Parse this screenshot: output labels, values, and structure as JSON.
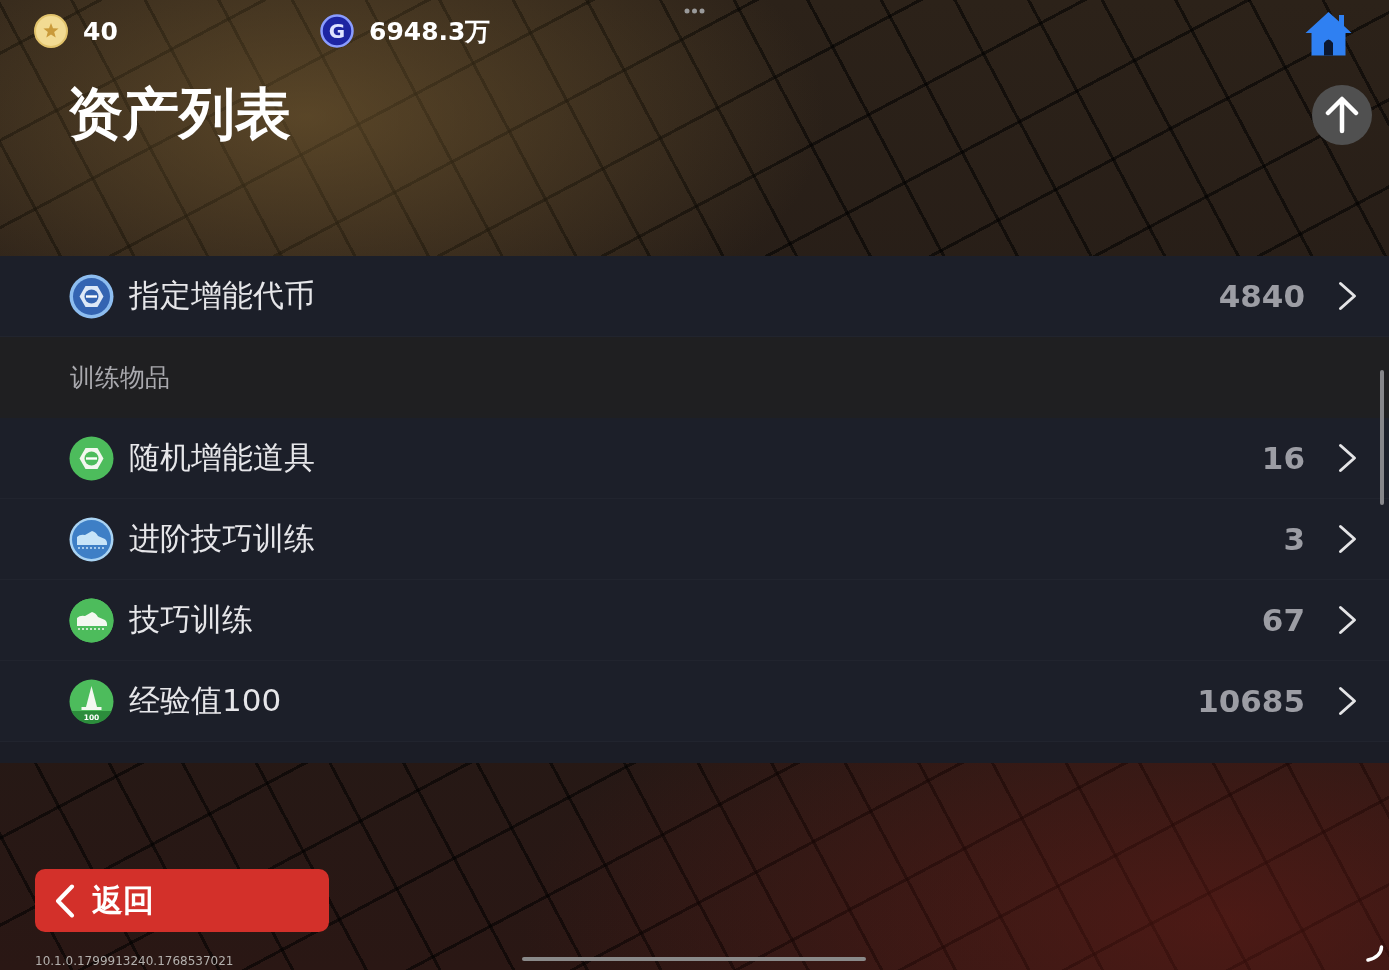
{
  "currencies": [
    {
      "kind": "star_coin",
      "amount": "40"
    },
    {
      "kind": "letter_coin",
      "symbol": "G",
      "amount": "6948.3万"
    }
  ],
  "title": "资产列表",
  "list": [
    {
      "kind": "token",
      "label": "指定增能代币",
      "value": "4840"
    },
    {
      "kind": "section",
      "label": "训练物品"
    },
    {
      "kind": "booster",
      "label": "随机增能道具",
      "value": "16"
    },
    {
      "kind": "advanced",
      "label": "进阶技巧训练",
      "value": "3"
    },
    {
      "kind": "drill",
      "label": "技巧训练",
      "value": "67"
    },
    {
      "kind": "experience",
      "badge": "100",
      "label": "经验值100",
      "value": "10685"
    }
  ],
  "back_button": {
    "label": "返回"
  },
  "version": "10.1.0.1799913240.1768537021"
}
